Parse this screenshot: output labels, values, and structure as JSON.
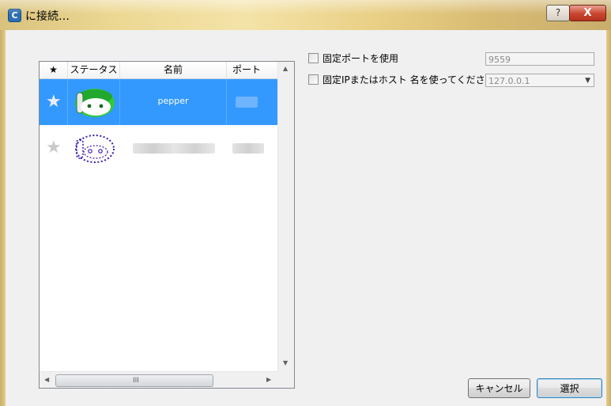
{
  "window": {
    "app_icon_letter": "C",
    "title": "に接続…",
    "help_label": "?",
    "close_label": "X"
  },
  "list": {
    "columns": [
      "★",
      "ステータス",
      "名前",
      "ポート"
    ],
    "rows": [
      {
        "favorite": true,
        "status_icon": "robot-online-icon",
        "name": "pepper",
        "port_obscured": true,
        "selected": true
      },
      {
        "favorite": false,
        "status_icon": "robot-offline-icon",
        "name_obscured": true,
        "port_obscured": true,
        "selected": false
      }
    ],
    "scroll_grip": "III"
  },
  "options": {
    "fixed_port_label": "固定ポートを使用",
    "fixed_port_value": "9559",
    "fixed_ip_label": "固定IPまたはホスト 名を使ってください",
    "fixed_ip_value": "127.0.0.1"
  },
  "buttons": {
    "cancel": "キャンセル",
    "select": "選択"
  },
  "colors": {
    "selection": "#3399ff",
    "robot_green": "#2fc93a",
    "offline_purple": "#3a1ab0"
  }
}
